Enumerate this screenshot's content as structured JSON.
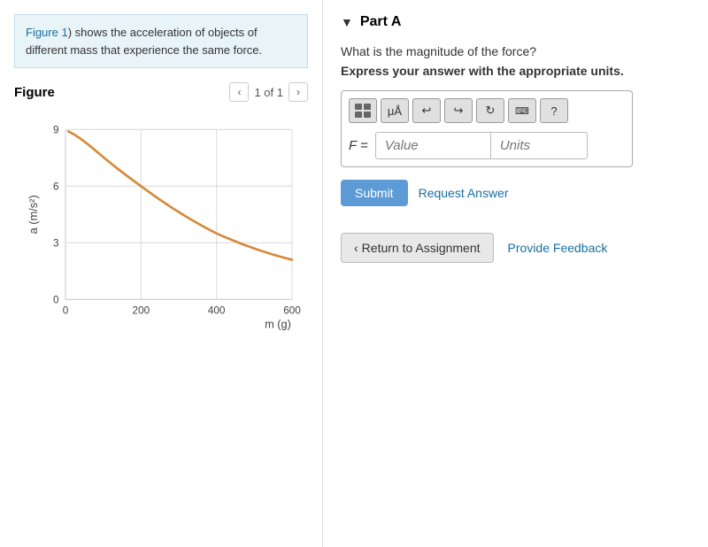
{
  "left": {
    "description_link": "Figure 1",
    "description_text": ") shows the acceleration of objects of different mass that experience the same force.",
    "figure_title": "Figure",
    "figure_nav": "1 of 1",
    "graph": {
      "x_label": "m (g)",
      "y_label": "a (m/s²)",
      "x_ticks": [
        "0",
        "200",
        "400",
        "600"
      ],
      "y_ticks": [
        "0",
        "3",
        "6",
        "9"
      ]
    }
  },
  "right": {
    "part_label": "Part A",
    "question": "What is the magnitude of the force?",
    "instruction": "Express your answer with the appropriate units.",
    "toolbar": {
      "matrix_label": "matrix",
      "mu_label": "μÅ",
      "undo_label": "↩",
      "redo_label": "↪",
      "refresh_label": "↻",
      "keyboard_label": "⌨",
      "help_label": "?"
    },
    "f_label": "F =",
    "value_placeholder": "Value",
    "units_placeholder": "Units",
    "submit_label": "Submit",
    "request_answer_label": "Request Answer",
    "return_label": "Return to Assignment",
    "feedback_label": "Provide Feedback"
  },
  "colors": {
    "accent": "#5c9bd6",
    "link": "#1a6fa0",
    "description_bg": "#e8f4f8",
    "curve": "#d48a3a"
  }
}
